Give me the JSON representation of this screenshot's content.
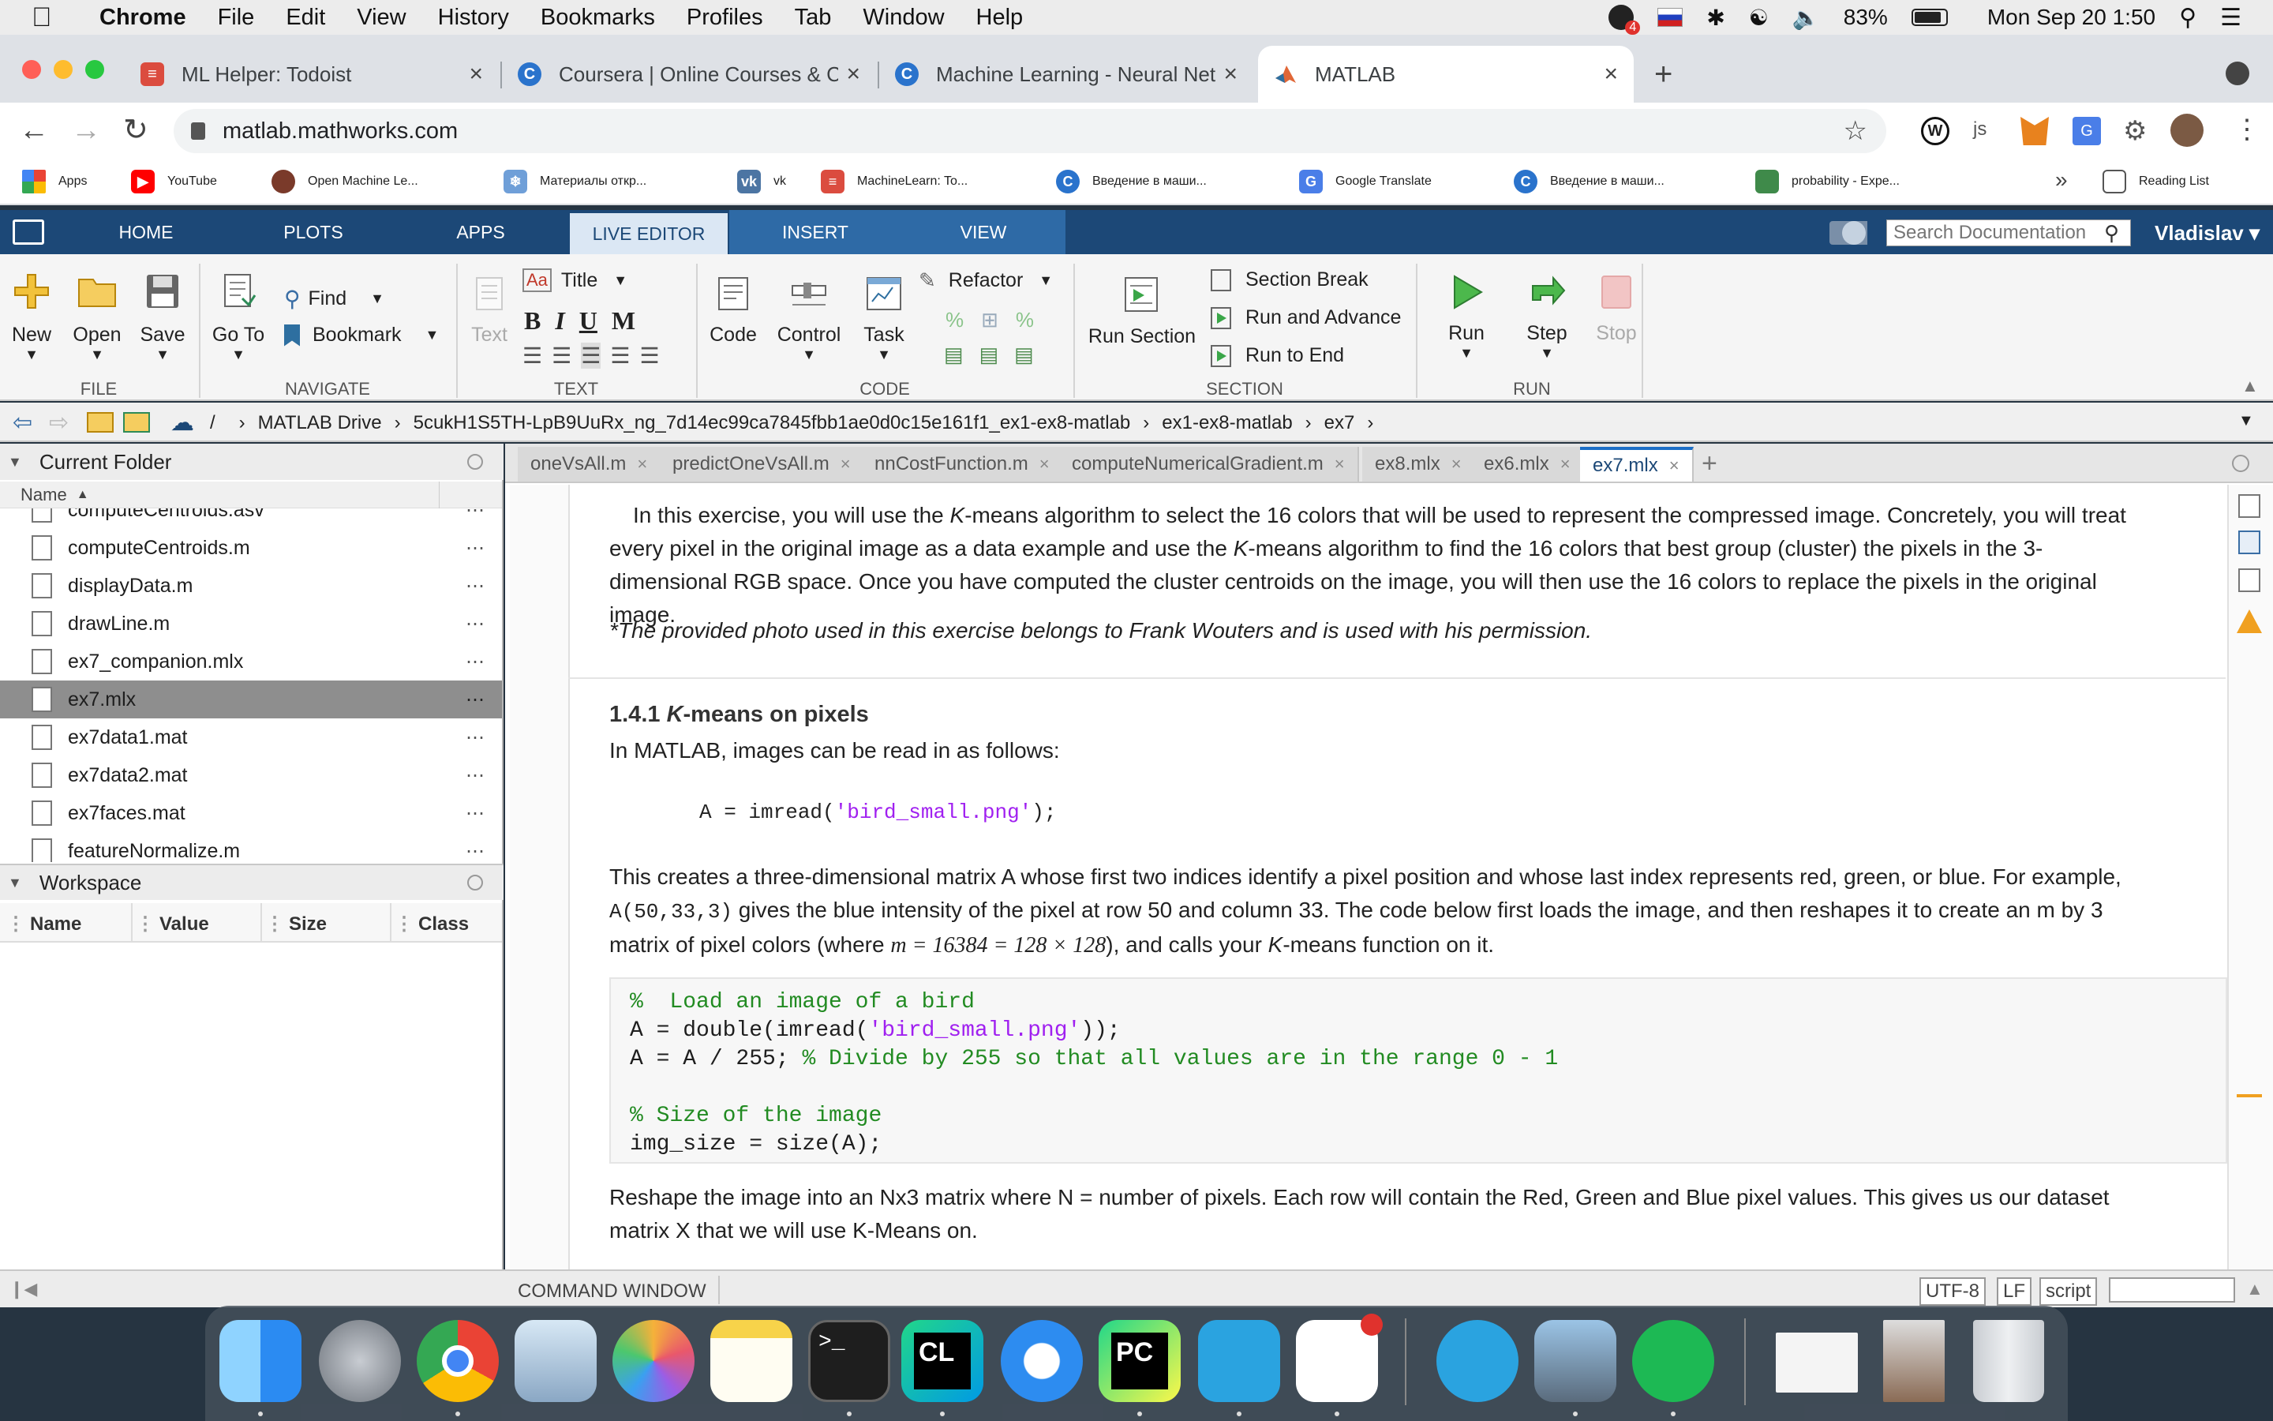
{
  "menubar": {
    "app_name": "Chrome",
    "items": [
      "File",
      "Edit",
      "View",
      "History",
      "Bookmarks",
      "Profiles",
      "Tab",
      "Window",
      "Help"
    ],
    "battery": "83%",
    "clock": "Mon Sep 20  1:50",
    "notification_count": "4"
  },
  "browser": {
    "tabs": [
      {
        "title": "ML Helper: Todoist",
        "icon": "todoist-icon"
      },
      {
        "title": "Coursera | Online Courses & C",
        "icon": "coursera-icon"
      },
      {
        "title": "Machine Learning - Neural Net",
        "icon": "coursera-icon"
      },
      {
        "title": "MATLAB",
        "icon": "matlab-icon"
      }
    ],
    "url": "matlab.mathworks.com",
    "bookmarks": [
      "Apps",
      "YouTube",
      "Open Machine Le...",
      "Материалы откр...",
      "vk",
      "MachineLearn: To...",
      "Введение в маши...",
      "Google Translate",
      "Введение в маши...",
      "probability - Expe..."
    ],
    "overflow": "»",
    "reading_list": "Reading List"
  },
  "matlab": {
    "ribbon_tabs": [
      "HOME",
      "PLOTS",
      "APPS",
      "LIVE EDITOR",
      "INSERT",
      "VIEW"
    ],
    "search_placeholder": "Search Documentation",
    "user": "Vladislav",
    "toolstrip": {
      "new": "New",
      "open": "Open",
      "save": "Save",
      "file_group": "FILE",
      "goto": "Go To",
      "find": "Find",
      "bookmark": "Bookmark",
      "navigate_group": "NAVIGATE",
      "text": "Text",
      "title_style": "Title",
      "text_group": "TEXT",
      "code": "Code",
      "control": "Control",
      "task": "Task",
      "refactor": "Refactor",
      "code_group": "CODE",
      "run_section": "Run Section",
      "section_break": "Section Break",
      "run_and_advance": "Run and Advance",
      "run_to_end": "Run to End",
      "section_group": "SECTION",
      "run": "Run",
      "step": "Step",
      "stop": "Stop",
      "run_group": "RUN"
    },
    "path": [
      "/",
      "MATLAB Drive",
      "5cukH1S5TH-LpB9UuRx_ng_7d14ec99ca7845fbb1ae0d0c15e161f1_ex1-ex8-matlab",
      "ex1-ex8-matlab",
      "ex7"
    ],
    "current_folder": {
      "title": "Current Folder",
      "column": "Name",
      "files": [
        "computeCentroids.asv",
        "computeCentroids.m",
        "displayData.m",
        "drawLine.m",
        "ex7_companion.mlx",
        "ex7.mlx",
        "ex7data1.mat",
        "ex7data2.mat",
        "ex7faces.mat",
        "featureNormalize.m"
      ],
      "selected": "ex7.mlx"
    },
    "workspace": {
      "title": "Workspace",
      "columns": [
        "Name",
        "Value",
        "Size",
        "Class"
      ]
    },
    "editor_tabs": [
      "oneVsAll.m",
      "predictOneVsAll.m",
      "nnCostFunction.m",
      "computeNumericalGradient.m",
      "ex8.mlx",
      "ex6.mlx",
      "ex7.mlx"
    ],
    "active_editor_tab": "ex7.mlx",
    "doc": {
      "para1a": "In this exercise, you will use the ",
      "k": "K",
      "para1b": "-means algorithm to select the 16 colors that will be used to represent the compressed image. Concretely, you will treat every pixel in the original image as a data example and use the ",
      "para1c": "-means algorithm to find the 16 colors that best group (cluster) the pixels in the 3-dimensional RGB space. Once you have computed the cluster centroids on the image, you will then use the 16 colors to replace the pixels in the original image.",
      "note": "*The provided photo used in this exercise belongs to Frank Wouters and is used with his permission.",
      "heading_num": "1.4.1 ",
      "heading_rest": "-means on pixels",
      "para2": "In MATLAB, images can be read in as follows:",
      "inline_code_a": "A = imread(",
      "inline_code_str": "'bird_small.png'",
      "inline_code_b": ");",
      "para3a": "This creates a three-dimensional matrix A whose first two indices identify a pixel position and whose last index represents red, green, or blue. For example, ",
      "para3_code": "A(50,33,3)",
      "para3b": " gives the blue intensity of the pixel at row 50 and column 33. The code below first loads the image, and then reshapes it to create an m by 3 matrix of pixel colors (where ",
      "para3_math": "m = 16384 = 128 × 128",
      "para3c": "), and calls your ",
      "para3d": "-means function on it.",
      "code_lines": [
        {
          "a": "%  Load an image of a bird",
          "kind": "comment"
        },
        {
          "a": "A = double(imread(",
          "s": "'bird_small.png'",
          "b": "));",
          "kind": "mixed"
        },
        {
          "a": "A = A / 255; ",
          "c": "% Divide by 255 so that all values are in the range 0 - 1",
          "kind": "codecomment"
        },
        {
          "a": "",
          "kind": "blank"
        },
        {
          "a": "% Size of the image",
          "kind": "comment"
        },
        {
          "a": "img_size = size(A);",
          "kind": "code"
        }
      ],
      "para4": "Reshape the image into an Nx3 matrix where N = number of pixels. Each row will contain the Red, Green and Blue pixel values. This gives us our dataset matrix X that we will use K-Means on."
    },
    "status": {
      "command_window": "COMMAND WINDOW",
      "encoding": "UTF-8",
      "line_ending": "LF",
      "type": "script"
    }
  },
  "dock": {
    "apps": [
      "finder-icon",
      "launchpad-icon",
      "chrome-icon",
      "preview-icon",
      "photos-icon",
      "notes-icon",
      "terminal-icon",
      "clion-icon",
      "safari-icon",
      "pycharm-icon",
      "telegram-icon",
      "slack-icon",
      "telegram-alt-icon",
      "image-capture-icon",
      "spotify-icon",
      "document-thumbnail-icon",
      "photo-thumbnail-icon",
      "trash-icon"
    ]
  }
}
